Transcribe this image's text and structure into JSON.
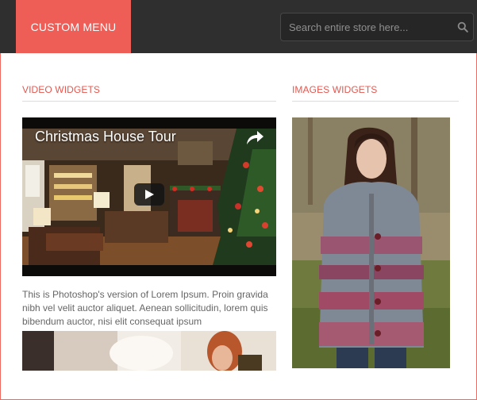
{
  "header": {
    "menu_label": "CUSTOM MENU",
    "search": {
      "placeholder": "Search entire store here...",
      "value": "",
      "icon": "search-icon"
    }
  },
  "video_widgets": {
    "title": "VIDEO WIDGETS",
    "video": {
      "title": "Christmas House Tour",
      "share_icon": "share-icon",
      "play_icon": "play-icon"
    },
    "description": "This is Photoshop's version of Lorem Ipsum. Proin gravida nibh vel velit auctor aliquet. Aenean sollicitudin, lorem quis bibendum auctor, nisi elit consequat ipsum"
  },
  "images_widgets": {
    "title": "IMAGES WIDGETS"
  },
  "colors": {
    "accent": "#ee5d56",
    "topbar": "#2f2f2f",
    "heading": "#e4574e",
    "body_text": "#666666"
  }
}
